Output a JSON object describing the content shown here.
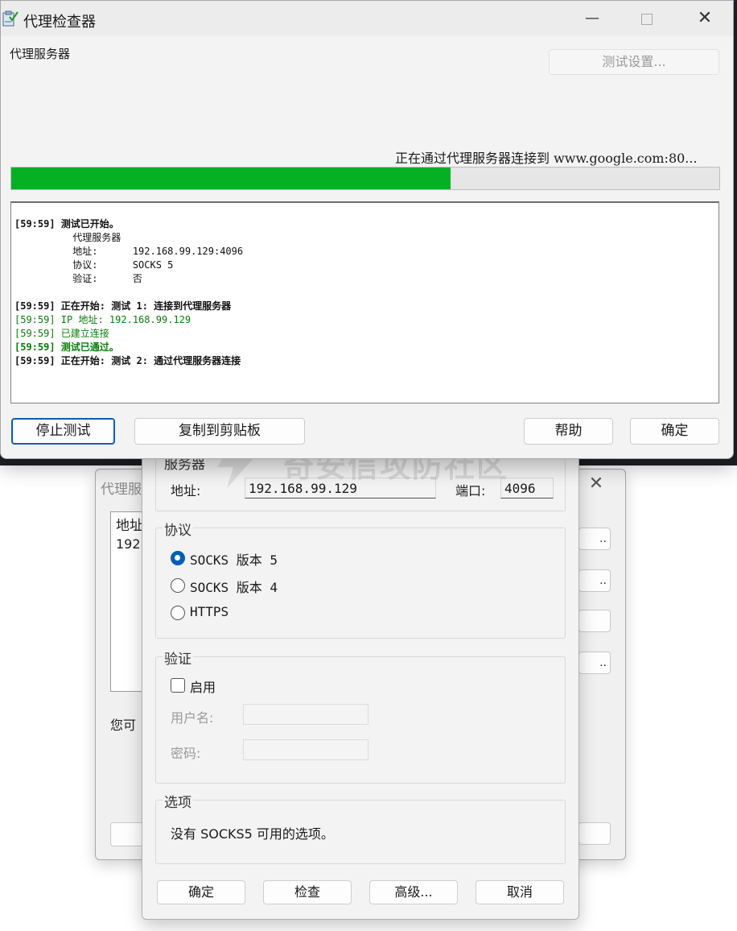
{
  "checker_window": {
    "title": "代理检查器",
    "proxy_label": "代理服务器",
    "test_settings_button": "测试设置...",
    "status": "正在通过代理服务器连接到 www.google.com:80...",
    "progress_fraction": 0.62,
    "log": [
      {
        "text": "[59:59] 测试已开始。",
        "style": "bold black"
      },
      {
        "text": "          代理服务器",
        "style": "black"
      },
      {
        "text": "          地址:      192.168.99.129:4096",
        "style": "black"
      },
      {
        "text": "          协议:      SOCKS 5",
        "style": "black"
      },
      {
        "text": "          验证:      否",
        "style": "black"
      },
      {
        "text": "[59:59] 正在开始: 测试 1: 连接到代理服务器",
        "style": "bold black"
      },
      {
        "text": "[59:59] IP 地址: 192.168.99.129",
        "style": "green"
      },
      {
        "text": "[59:59] 已建立连接",
        "style": "green"
      },
      {
        "text": "[59:59] 测试已通过。",
        "style": "bold green"
      },
      {
        "text": "[59:59] 正在开始: 测试 2: 通过代理服务器连接",
        "style": "bold black"
      }
    ],
    "buttons": {
      "stop": "停止测试",
      "copy": "复制到剪贴板",
      "help": "帮助",
      "ok": "确定"
    }
  },
  "settings_window": {
    "server_group": "服务器",
    "address_label": "地址:",
    "address_value": "192.168.99.129",
    "port_label": "端口:",
    "port_value": "4096",
    "protocol_group": "协议",
    "protocols": [
      "SOCKS 版本 5",
      "SOCKS 版本 4",
      "HTTPS"
    ],
    "selected_protocol": "SOCKS 版本 5",
    "auth_group": "验证",
    "auth_enable_label": "启用",
    "auth_enabled": false,
    "username_label": "用户名:",
    "password_label": "密码:",
    "options_group": "选项",
    "options_text": "没有 SOCKS5 可用的选项。",
    "buttons": {
      "ok": "确定",
      "check": "检查",
      "advanced": "高级...",
      "cancel": "取消"
    }
  },
  "list_window": {
    "title_partial": "代理服",
    "list_header_partial": "地址",
    "list_row_partial": "192.",
    "hint_partial": "您可"
  },
  "watermark": "奇安信攻防社区"
}
